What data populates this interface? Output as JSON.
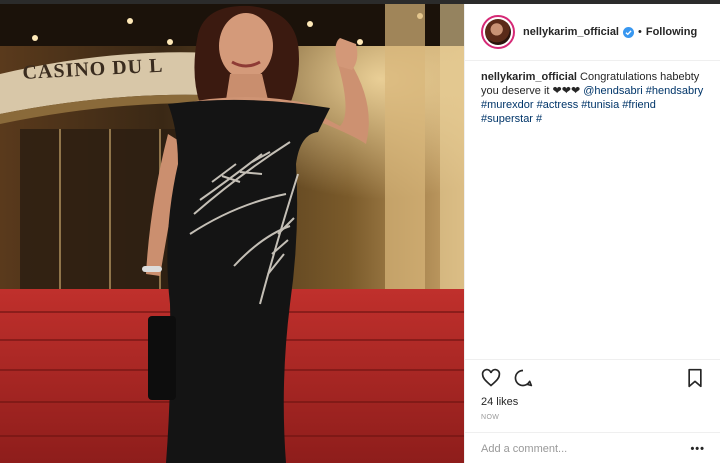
{
  "photo": {
    "sign_text": "CASINO DU L",
    "alt": "Post photo"
  },
  "post": {
    "username": "nellykarim_official",
    "follow_separator": "•",
    "follow_status": "Following",
    "caption_user": "nellykarim_official",
    "caption_text": " Congratulations habebty you deserve it ❤❤❤ ",
    "caption_tags": [
      "@hendsabri",
      "#hendsabry",
      "#murexdor",
      "#actress",
      "#tunisia",
      "#friend",
      "#superstar",
      "#"
    ],
    "likes": "24 likes",
    "timestamp": "NOW",
    "comment_placeholder": "Add a comment...",
    "more_label": "•••"
  },
  "icons": {
    "like": "heart-icon",
    "comment": "comment-icon",
    "save": "bookmark-icon",
    "verified": "verified-badge-icon"
  },
  "colors": {
    "link": "#003569",
    "verified": "#3897f0",
    "story_ring": "#d62976",
    "text": "#262626",
    "muted": "#999999"
  }
}
